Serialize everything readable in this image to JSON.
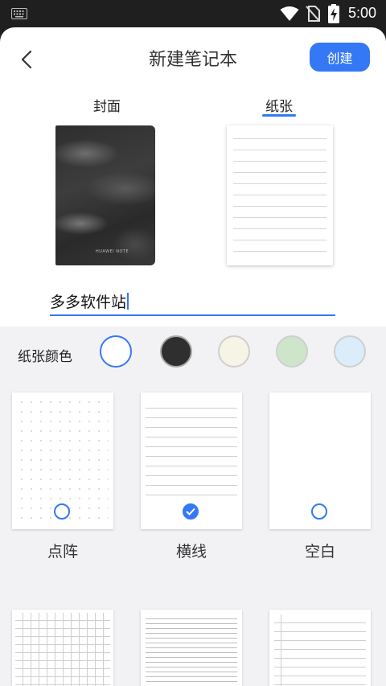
{
  "status_bar": {
    "time": "5:00"
  },
  "header": {
    "title": "新建笔记本",
    "create_label": "创建"
  },
  "tabs": [
    {
      "label": "封面"
    },
    {
      "label": "纸张"
    }
  ],
  "cover": {
    "brand_text": "HUAWEI NOTE"
  },
  "name_field": {
    "value": "多多软件站"
  },
  "paper_color": {
    "label": "纸张颜色",
    "swatches": [
      {
        "color": "#ffffff",
        "selected": true
      },
      {
        "color": "#2f2f2f",
        "selected": false
      },
      {
        "color": "#f6f4e4",
        "selected": false
      },
      {
        "color": "#cfe5cb",
        "selected": false
      },
      {
        "color": "#dbecfa",
        "selected": false
      }
    ]
  },
  "templates": [
    {
      "label": "点阵",
      "pattern": "dot-grid",
      "selected": false
    },
    {
      "label": "横线",
      "pattern": "lined",
      "selected": true
    },
    {
      "label": "空白",
      "pattern": "blank",
      "selected": false
    },
    {
      "label": "",
      "pattern": "grid",
      "selected": false
    },
    {
      "label": "",
      "pattern": "dense-lined",
      "selected": false
    },
    {
      "label": "",
      "pattern": "checklist",
      "selected": false
    }
  ],
  "colors": {
    "accent": "#3478f6"
  }
}
